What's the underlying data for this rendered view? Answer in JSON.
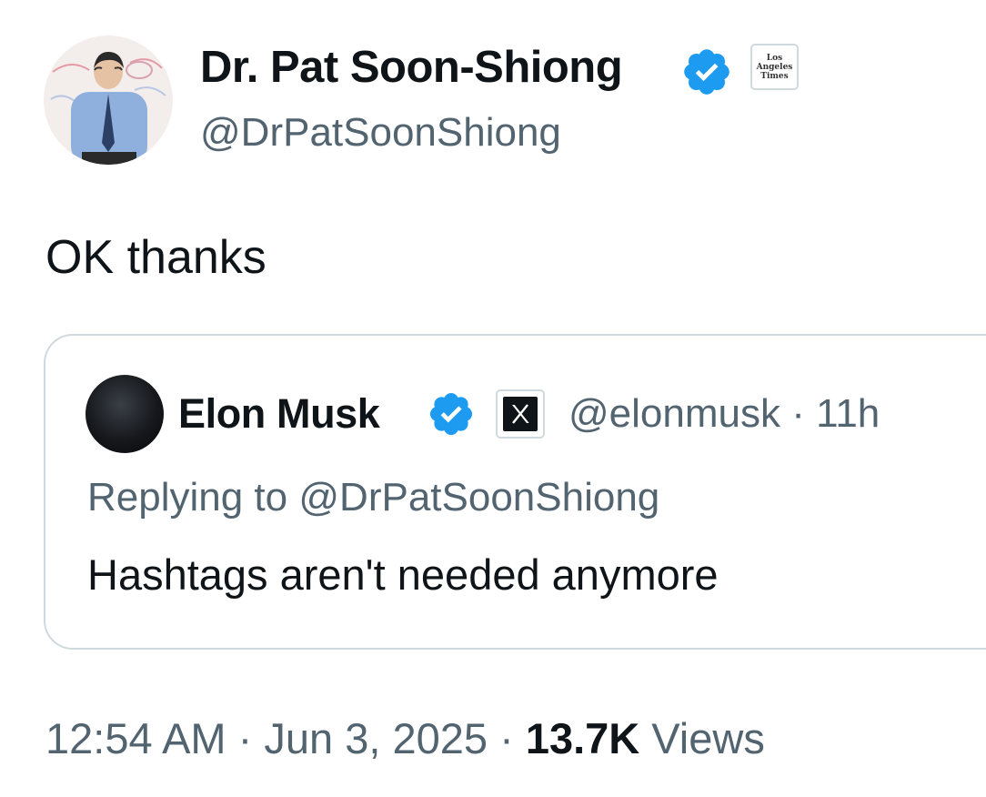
{
  "tweet": {
    "author": {
      "name": "Dr. Pat Soon-Shiong",
      "handle": "@DrPatSoonShiong",
      "verified_badge_color": "#1d9bf0",
      "affiliation": {
        "icon": "los-angeles-times-logo",
        "logo_text": [
          "Los",
          "Angeles",
          "Times"
        ]
      }
    },
    "text": "OK thanks",
    "quoted_tweet": {
      "author": {
        "name": "Elon Musk",
        "handle": "@elonmusk",
        "verified_badge_color": "#1d9bf0",
        "affiliation": {
          "icon": "x-logo"
        }
      },
      "separator": "·",
      "time_ago": "11h",
      "replying_prefix": "Replying to",
      "replying_to": "@DrPatSoonShiong",
      "text": "Hashtags aren't needed anymore"
    },
    "time": "12:54 AM",
    "separator": "·",
    "date": "Jun 3, 2025",
    "views_count": "13.7K",
    "views_label": "Views"
  },
  "colors": {
    "text_primary": "#0f1419",
    "text_secondary": "#536471",
    "border": "#cfd9de",
    "accent_blue": "#1d9bf0"
  }
}
